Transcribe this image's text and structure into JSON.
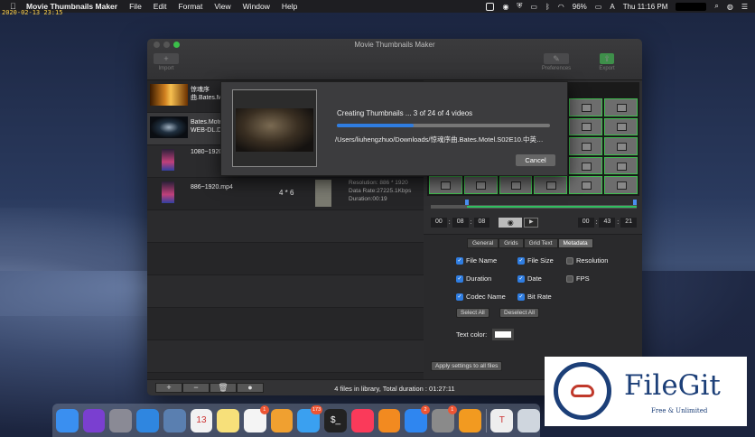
{
  "menubar": {
    "app_name": "Movie Thumbnails Maker",
    "menus": [
      "File",
      "Edit",
      "Format",
      "View",
      "Window",
      "Help"
    ],
    "battery": "96%",
    "input_source": "A",
    "clock": "Thu 11:16 PM"
  },
  "stamp": "2020-02-13 23:15",
  "window": {
    "title": "Movie Thumbnails Maker",
    "toolbar": {
      "import_label": "Import",
      "preferences_label": "Preferences",
      "export_label": "Export"
    }
  },
  "files": [
    {
      "name_line1": "惊魂序",
      "name_line2": "曲.Bates.M",
      "thumb": "fire"
    },
    {
      "name_line1": "Bates.Mote",
      "name_line2": "WEB-DL.DD",
      "thumb": "dark"
    },
    {
      "name": "1080~1920",
      "thumb": "portrait"
    },
    {
      "name": "886~1920.mp4",
      "grid": "4 * 6",
      "resolution": "Resolution: 886 * 1920",
      "data_rate": "Data Rate:27225.1Kbps",
      "duration": "Duration:00:19",
      "thumb": "portrait"
    }
  ],
  "timebar": {
    "start": [
      "00",
      "08",
      "08"
    ],
    "end": [
      "00",
      "43",
      "21"
    ],
    "eye_icon": "eye-icon",
    "play_icon": "play-icon"
  },
  "settings": {
    "tabs": [
      "General",
      "Grids",
      "Grid Text",
      "Metadata"
    ],
    "active_tab": "Metadata",
    "checkboxes": [
      {
        "label": "File Name",
        "checked": true
      },
      {
        "label": "File Size",
        "checked": true
      },
      {
        "label": "Resolution",
        "checked": false
      },
      {
        "label": "Duration",
        "checked": true
      },
      {
        "label": "Date",
        "checked": true
      },
      {
        "label": "FPS",
        "checked": false
      },
      {
        "label": "Codec Name",
        "checked": true
      },
      {
        "label": "Bit Rate",
        "checked": true
      }
    ],
    "select_all": "Select All",
    "deselect_all": "Deselect All",
    "text_color_label": "Text color:",
    "text_color": "#ffffff",
    "apply_all": "Apply settings to all files"
  },
  "bottombar": {
    "buttons": [
      "+",
      "−",
      "🗑",
      "●"
    ],
    "status": "4 files in library, Total duration : 01:27:11"
  },
  "sheet": {
    "message": "Creating Thumbnails ... 3 of 24 of 4 videos",
    "progress": 0.36,
    "path": "/Users/liuhengzhuo/Downloads/惊魂序曲.Bates.Motel.S02E10.中英…",
    "cancel": "Cancel"
  },
  "dock": {
    "icons": [
      {
        "name": "finder-icon",
        "color": "#3a8ff0"
      },
      {
        "name": "siri-icon",
        "color": "#7a3fd0"
      },
      {
        "name": "launchpad-icon",
        "color": "#8a8a95"
      },
      {
        "name": "safari-icon",
        "color": "#2f86e0"
      },
      {
        "name": "photo-app-icon",
        "color": "#5a7fb0"
      },
      {
        "name": "calendar-icon",
        "color": "#f2f2f2",
        "text": "13"
      },
      {
        "name": "notes-icon",
        "color": "#f7e07a"
      },
      {
        "name": "reminders-icon",
        "color": "#f4f4f4",
        "badge": "1"
      },
      {
        "name": "photos-icon",
        "color": "#f0a030"
      },
      {
        "name": "messages-icon",
        "color": "#3aa0f0",
        "badge": "173"
      },
      {
        "name": "terminal-icon",
        "color": "#222222",
        "text": "$_"
      },
      {
        "name": "music-icon",
        "color": "#fa3a5a"
      },
      {
        "name": "books-icon",
        "color": "#f28a20"
      },
      {
        "name": "app-store-icon",
        "color": "#2f86f0",
        "badge": "2"
      },
      {
        "name": "system-preferences-icon",
        "color": "#8a8a8a",
        "badge": "1"
      },
      {
        "name": "sublime-icon",
        "color": "#f29a20"
      },
      {
        "name": "typora-icon",
        "color": "#eeeeee",
        "text": "T"
      },
      {
        "name": "trash-icon",
        "color": "#cfd6de"
      }
    ]
  },
  "watermark": {
    "title": "FileGit",
    "subtitle": "Free & Unlimited"
  }
}
